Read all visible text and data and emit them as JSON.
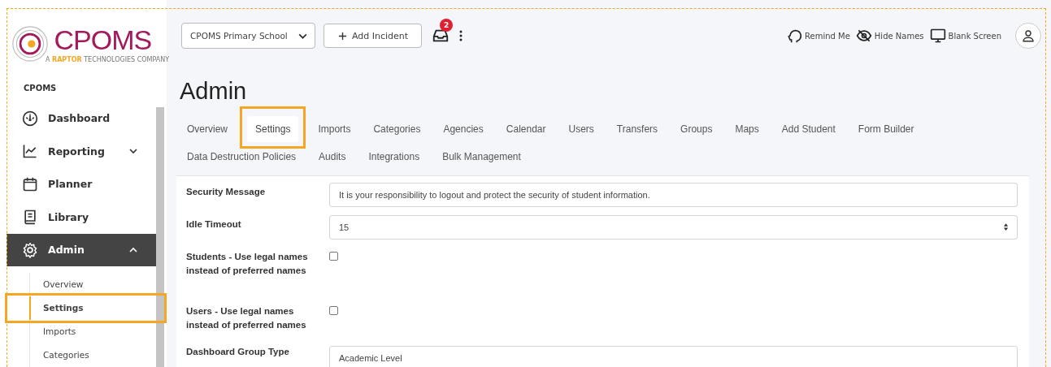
{
  "logo": {
    "name": "CPOMS",
    "tagline_prefix": "A",
    "tagline_brand": "RAPTOR",
    "tagline_suffix": "TECHNOLOGIES COMPANY"
  },
  "sidebar": {
    "section": "CPOMS",
    "items": [
      {
        "label": "Dashboard",
        "selected": false
      },
      {
        "label": "Reporting",
        "expanded": false,
        "selected": false
      },
      {
        "label": "Planner",
        "selected": false
      },
      {
        "label": "Library",
        "selected": false
      },
      {
        "label": "Admin",
        "expanded": true,
        "selected": true
      }
    ],
    "subitems": [
      {
        "label": "Overview",
        "selected": false,
        "annotated": false
      },
      {
        "label": "Settings",
        "selected": true,
        "annotated": true
      },
      {
        "label": "Imports",
        "selected": false,
        "annotated": false
      },
      {
        "label": "Categories",
        "selected": false,
        "annotated": false
      }
    ]
  },
  "topbar": {
    "school_select": "CPOMS Primary School",
    "add_button": "Add Incident",
    "inbox_badge": "2",
    "actions": [
      {
        "label": "Remind Me"
      },
      {
        "label": "Hide Names"
      },
      {
        "label": "Blank Screen"
      }
    ]
  },
  "page_title": "Admin",
  "tab_rows": [
    [
      {
        "label": "Overview",
        "selected": false,
        "annotated": false
      },
      {
        "label": "Settings",
        "selected": true,
        "annotated": true
      },
      {
        "label": "Imports",
        "selected": false,
        "annotated": false
      },
      {
        "label": "Categories",
        "selected": false,
        "annotated": false
      },
      {
        "label": "Agencies",
        "selected": false,
        "annotated": false
      },
      {
        "label": "Calendar",
        "selected": false,
        "annotated": false
      },
      {
        "label": "Users",
        "selected": false,
        "annotated": false
      },
      {
        "label": "Transfers",
        "selected": false,
        "annotated": false
      },
      {
        "label": "Groups",
        "selected": false,
        "annotated": false
      },
      {
        "label": "Maps",
        "selected": false,
        "annotated": false
      },
      {
        "label": "Add Student",
        "selected": false,
        "annotated": false
      },
      {
        "label": "Form Builder",
        "selected": false,
        "annotated": false
      }
    ],
    [
      {
        "label": "Data Destruction Policies",
        "selected": false,
        "annotated": false
      },
      {
        "label": "Audits",
        "selected": false,
        "annotated": false
      },
      {
        "label": "Integrations",
        "selected": false,
        "annotated": false
      },
      {
        "label": "Bulk Management",
        "selected": false,
        "annotated": false
      }
    ]
  ],
  "form": [
    {
      "kind": "text",
      "label": "Security Message",
      "value": "It is your responsibility to logout and protect the security of student information."
    },
    {
      "kind": "number",
      "label": "Idle Timeout",
      "value": "15"
    },
    {
      "kind": "checkbox",
      "label": "Students - Use legal names instead of preferred names",
      "checked": false
    },
    {
      "kind": "checkbox",
      "label": "Users - Use legal names instead of preferred names",
      "checked": false
    },
    {
      "kind": "select",
      "label": "Dashboard Group Type",
      "value": "Academic Level"
    }
  ]
}
